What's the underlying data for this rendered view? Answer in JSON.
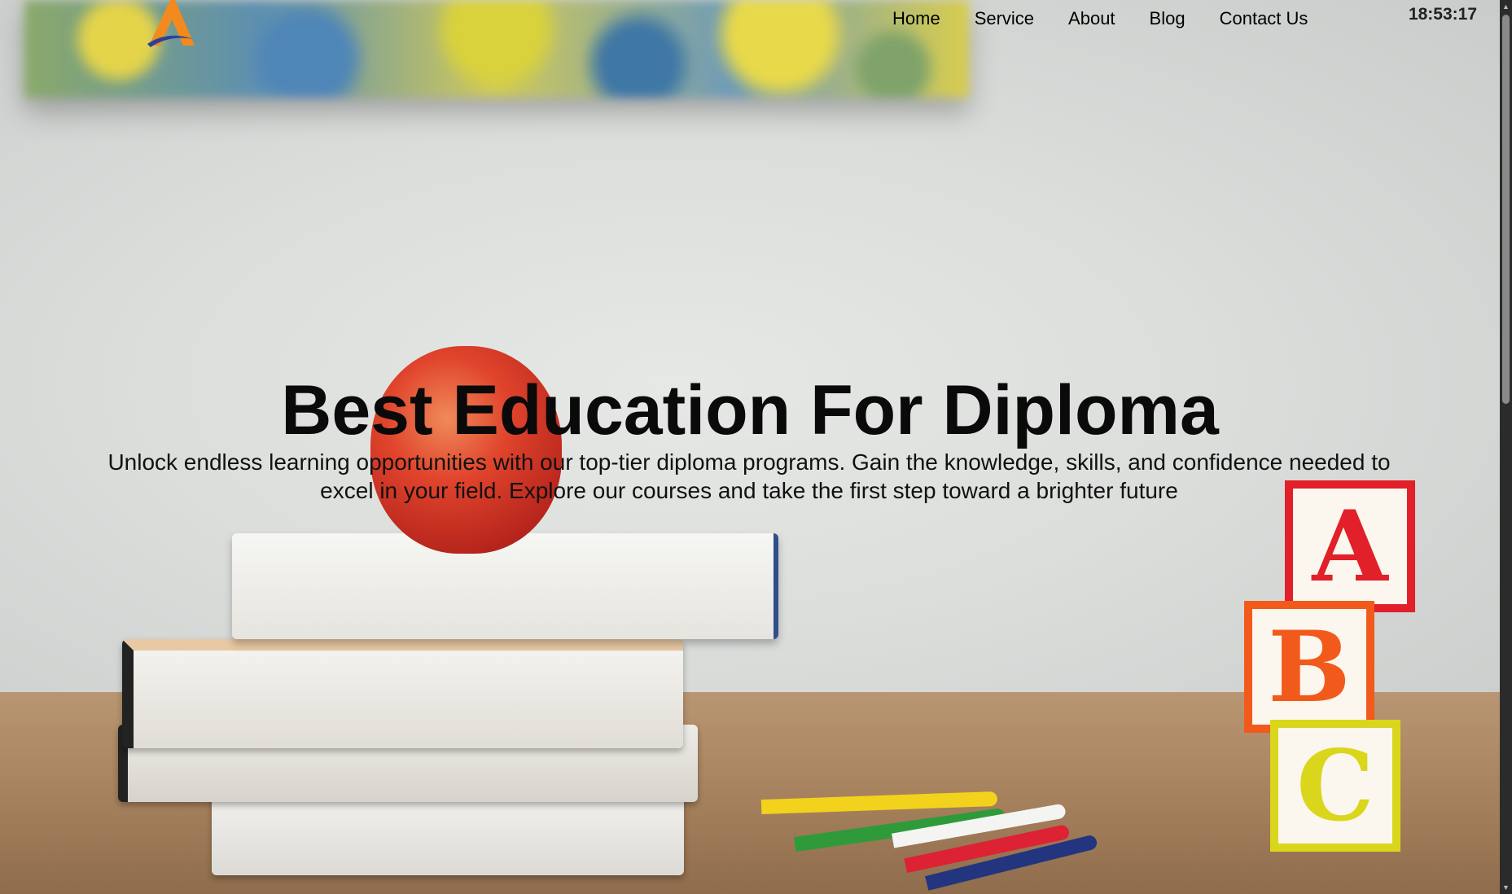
{
  "header": {
    "logo_icon": "a-logo-icon",
    "nav": [
      {
        "label": "Home"
      },
      {
        "label": "Service"
      },
      {
        "label": "About"
      },
      {
        "label": "Blog"
      },
      {
        "label": "Contact Us"
      }
    ],
    "clock": "18:53:17"
  },
  "hero": {
    "title": "Best Education For Diploma",
    "description": "Unlock endless learning opportunities with our top-tier diploma programs. Gain the knowledge, skills, and confidence needed to excel in your field. Explore our courses and take the first step toward a brighter future"
  },
  "background": {
    "blocks": [
      "A",
      "B",
      "C"
    ]
  },
  "colors": {
    "logo_orange": "#f28a1e",
    "logo_blue": "#2c3f9a",
    "text": "#0a0a0a"
  }
}
